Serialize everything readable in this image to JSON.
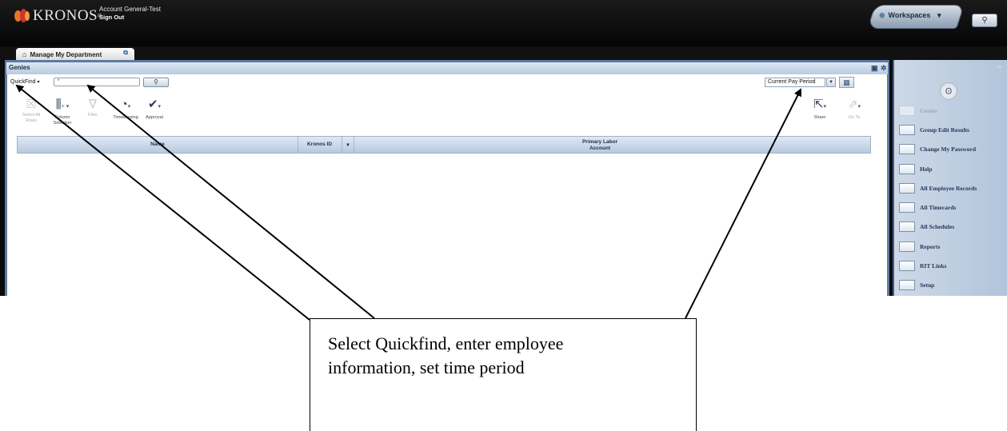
{
  "header": {
    "brand": "KRONOS",
    "brand_reg": "®",
    "account_name": "Account General-Test",
    "sign_out": "Sign Out",
    "workspaces_label": "Workspaces",
    "workspaces_caret": "▾",
    "search_icon": "search-icon"
  },
  "tabs": [
    {
      "label": "Manage My Department",
      "icon": "home-icon"
    }
  ],
  "genies": {
    "title": "Genies"
  },
  "toolbar": {
    "quickfind_label": "QuickFind",
    "quickfind_caret": "▾",
    "search_value": "*",
    "search_button": "🔍",
    "time_period": "Current Pay Period",
    "buttons": {
      "select_all": "Select All Rows",
      "column_selection": "Column Selection",
      "filter": "Filter",
      "timekeeping": "Timekeeping",
      "approval": "Approval",
      "share": "Share",
      "go_to": "Go To"
    }
  },
  "grid": {
    "columns": [
      "Name",
      "Kronos ID",
      "Primary Labor Account"
    ]
  },
  "sidebar": {
    "items": [
      {
        "label": "Genies",
        "enabled": false
      },
      {
        "label": "Group Edit Results",
        "enabled": true
      },
      {
        "label": "Change My Password",
        "enabled": true
      },
      {
        "label": "Help",
        "enabled": true
      },
      {
        "label": "All Employee Records",
        "enabled": true
      },
      {
        "label": "All Timecards",
        "enabled": true
      },
      {
        "label": "All Schedules",
        "enabled": true
      },
      {
        "label": "Reports",
        "enabled": true
      },
      {
        "label": "RIT Links",
        "enabled": true
      },
      {
        "label": "Setup",
        "enabled": true
      }
    ]
  },
  "annotation": {
    "line1": "Select Quickfind, enter employee",
    "line2": "information, set time period"
  },
  "colors": {
    "header_bg": "#0b0b0b",
    "panel_border": "#5d7aa3",
    "sidebar_bg": "#c2d1e3",
    "logo_orange": "#e8742a",
    "logo_red": "#c8372d"
  }
}
